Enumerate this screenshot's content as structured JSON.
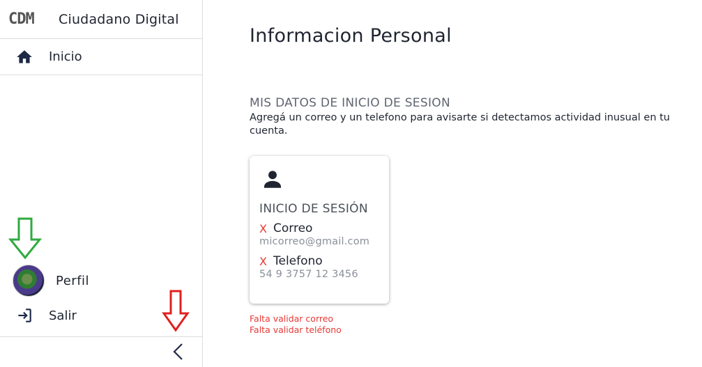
{
  "sidebar": {
    "logo": "CDM",
    "app_title": "Ciudadano Digital",
    "nav": {
      "home_label": "Inicio"
    },
    "profile_label": "Perfil",
    "logout_label": "Salir"
  },
  "main": {
    "page_title": "Informacion Personal",
    "section_title": "MIS DATOS DE INICIO DE SESION",
    "section_desc": "Agregá un correo y un telefono para avisarte si detectamos actividad inusual en tu cuenta.",
    "card": {
      "title": "INICIO DE SESIÓN",
      "email_label": "Correo",
      "email_value": "micorreo@gmail.com",
      "phone_label": "Telefono",
      "phone_value": "54 9 3757 12 3456",
      "status_mark": "X"
    },
    "errors": [
      "Falta validar correo",
      "Falta validar teléfono"
    ]
  },
  "colors": {
    "error": "#e53935",
    "text": "#1f2430",
    "arrow_green": "#2eaa3f",
    "arrow_red": "#e02020"
  },
  "icons": {
    "home": "home-icon",
    "person": "person-icon",
    "logout": "logout-icon",
    "collapse": "chevron-left-icon"
  }
}
